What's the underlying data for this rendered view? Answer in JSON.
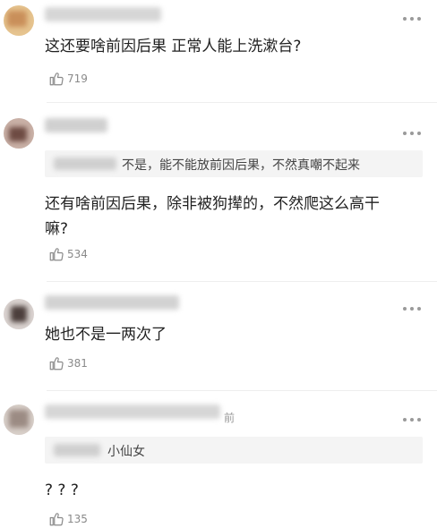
{
  "comments": [
    {
      "text": "这还要啥前因后果 正常人能上洗漱台?",
      "likes": "719"
    },
    {
      "quote": "不是，能不能放前因后果，不然真嘲不起来",
      "text": "还有啥前因后果，除非被狗撵的，不然爬这么高干嘛?",
      "likes": "534"
    },
    {
      "text": "她也不是一两次了",
      "likes": "381"
    },
    {
      "time_suffix": "前",
      "quote": "小仙女",
      "text": "? ? ?",
      "likes": "135"
    }
  ],
  "icons": {
    "like": "thumbs-up-icon",
    "more": "more-options-icon"
  },
  "colors": {
    "text": "#222222",
    "meta": "#8a8a8a",
    "quote_bg": "#f4f4f4",
    "divider": "#eeeeee"
  }
}
